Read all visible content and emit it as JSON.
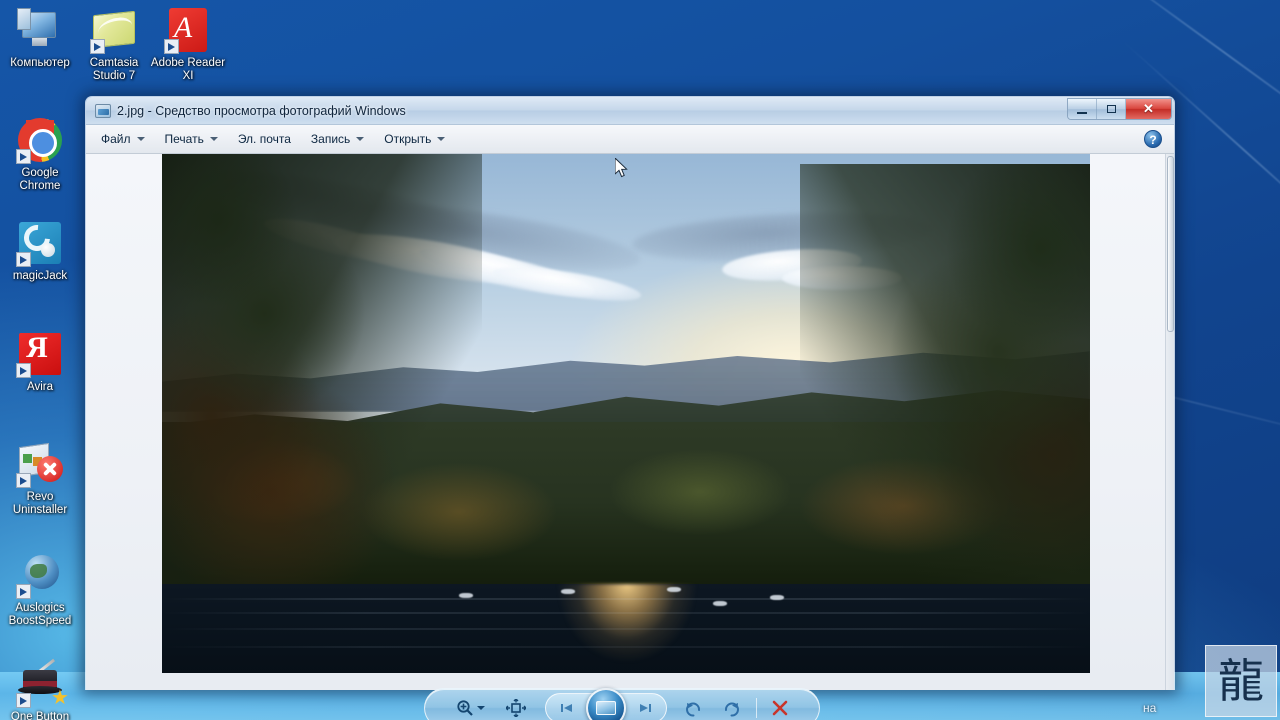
{
  "desktop": {
    "icons": [
      {
        "name": "computer",
        "label": "Компьютер",
        "shortcut": false
      },
      {
        "name": "camtasia",
        "label": "Camtasia\nStudio 7",
        "shortcut": true
      },
      {
        "name": "adobe",
        "label": "Adobe\nReader XI",
        "shortcut": true
      },
      {
        "name": "chrome",
        "label": "Google\nChrome",
        "shortcut": true
      },
      {
        "name": "magicjack",
        "label": "magicJack",
        "shortcut": true
      },
      {
        "name": "avira",
        "label": "Avira",
        "shortcut": true
      },
      {
        "name": "revo",
        "label": "Revo\nUninstaller",
        "shortcut": true
      },
      {
        "name": "auslogics",
        "label": "Auslogics\nBoostSpeed",
        "shortcut": true
      },
      {
        "name": "onebutton",
        "label": "One Button",
        "shortcut": true
      }
    ],
    "gadget": {
      "name": "dragon-gadget",
      "glyph": "龍"
    },
    "taskbar_partial_text": "на",
    "wallpaper_color": "#11448e"
  },
  "window": {
    "title": "2.jpg - Средство просмотра фотографий Windows",
    "controls": {
      "minimize": "Свернуть",
      "maximize": "Развернуть",
      "close": "Закрыть",
      "close_glyph": "✕"
    },
    "menu": [
      {
        "label": "Файл",
        "has_caret": true
      },
      {
        "label": "Печать",
        "has_caret": true
      },
      {
        "label": "Эл. почта",
        "has_caret": false
      },
      {
        "label": "Запись",
        "has_caret": true
      },
      {
        "label": "Открыть",
        "has_caret": true
      }
    ],
    "help_label": "?",
    "accent_close": "#c42d26"
  },
  "photo": {
    "description": "Осенний лес над озером на закате",
    "alt": "Autumn forest lake at sunset"
  },
  "toolbar": {
    "zoom": "Изменить размер изображения",
    "fit": "Размер по размеру окна",
    "previous": "Предыдущее изображение",
    "play": "Показ слайдов",
    "next": "Следующее изображение",
    "rotate_ccw": "Повернуть против часовой стрелки",
    "rotate_cw": "Повернуть по часовой стрелке",
    "delete": "Удалить"
  }
}
